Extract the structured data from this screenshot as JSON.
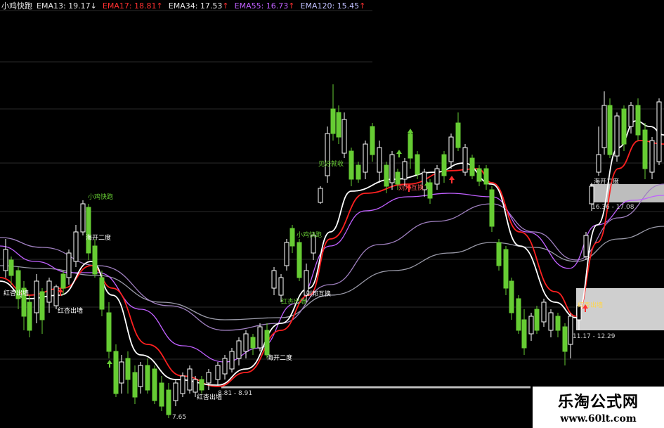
{
  "header": {
    "title": "小鸡快跑",
    "items": [
      {
        "label": "EMA13: 19.17",
        "arrow": "↓",
        "color": "#e6e6e6",
        "arrowColor": "#e6e6e6"
      },
      {
        "label": "EMA17: 18.81",
        "arrow": "↑",
        "color": "#ff3030",
        "arrowColor": "#ff3030"
      },
      {
        "label": "EMA34: 17.53",
        "arrow": "↑",
        "color": "#e6e6e6",
        "arrowColor": "#ff3030"
      },
      {
        "label": "EMA55: 16.73",
        "arrow": "↑",
        "color": "#c060ff",
        "arrowColor": "#ff3030"
      },
      {
        "label": "EMA120: 15.45",
        "arrow": "↑",
        "color": "#c0c0ff",
        "arrowColor": "#ff3030"
      }
    ]
  },
  "colors": {
    "background": "#000000",
    "up": "#ffffff",
    "down": "#66cc33",
    "ema13": "#ffffff",
    "ema17": "#ff2020",
    "ema34": "#c060ff",
    "ema55": "#a080c0",
    "ema120": "#9a9aa8",
    "annotation_green": "#66cc33",
    "annotation_red": "#ff5555",
    "annotation_white": "#ffffff"
  },
  "chart_data": {
    "type": "candlestick",
    "indicator_lines": [
      "EMA13",
      "EMA17",
      "EMA34",
      "EMA55",
      "EMA120"
    ],
    "price_labels": [
      {
        "text": "7.65"
      },
      {
        "text": "8.81 - 8.91"
      },
      {
        "text": "16.36 - 17.08"
      },
      {
        "text": "11.17 - 12.29"
      }
    ],
    "annotations": [
      {
        "text": "小鸡快跑",
        "color": "green"
      },
      {
        "text": "海开二度",
        "color": "white"
      },
      {
        "text": "红杏出墙",
        "color": "white"
      },
      {
        "text": "红杏出墙",
        "color": "white"
      },
      {
        "text": "红杏出墙",
        "color": "white"
      },
      {
        "text": "小鸡快跑",
        "color": "green"
      },
      {
        "text": "红杏出墙",
        "color": "green"
      },
      {
        "text": "刘邦互换",
        "color": "white"
      },
      {
        "text": "海开二度",
        "color": "white"
      },
      {
        "text": "见好就收",
        "color": "green"
      },
      {
        "text": "刘邦互换",
        "color": "red"
      },
      {
        "text": "海开二度",
        "color": "white"
      },
      {
        "text": "红杏出墙",
        "color": "yellow"
      }
    ]
  },
  "watermark": {
    "line1": "乐淘公式网",
    "line2": "www.60lt.com"
  }
}
